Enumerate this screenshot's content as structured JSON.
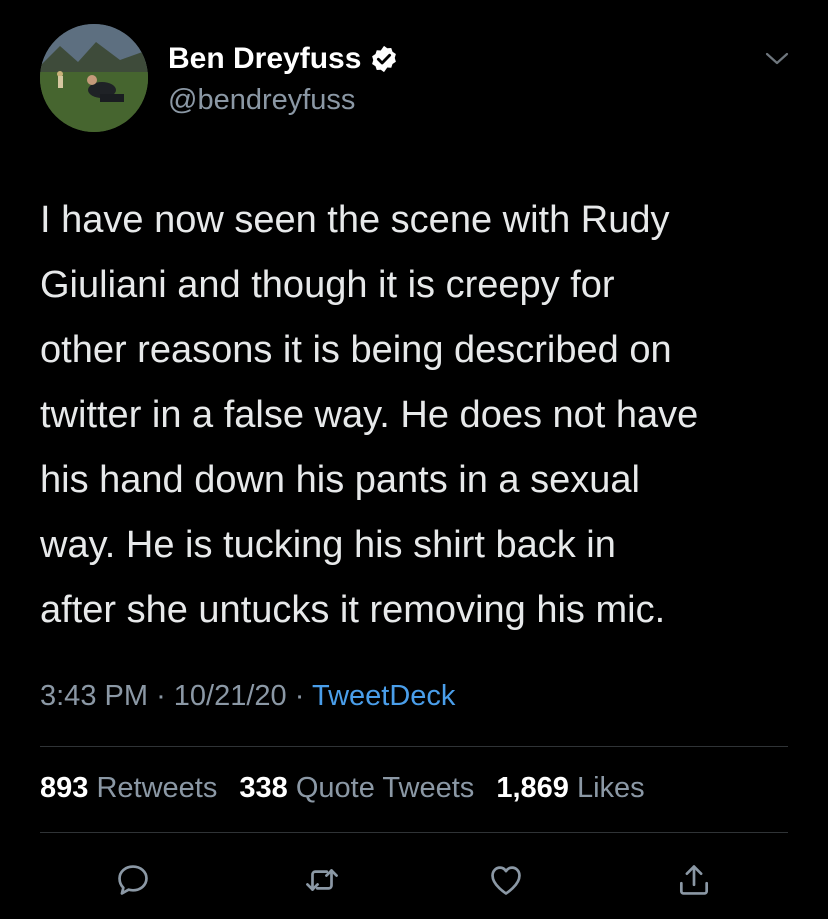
{
  "author": {
    "name": "Ben Dreyfuss",
    "handle": "@bendreyfuss",
    "verified": true
  },
  "tweet": {
    "text": "I have now seen the scene with Rudy\nGiuliani and though it is creepy for\nother reasons it is being described on\ntwitter in a false way. He does not have\nhis hand down his pants in a sexual\nway. He is tucking his shirt back in\nafter she untucks it removing his mic.",
    "time": "3:43 PM",
    "separator": "·",
    "date": "10/21/20",
    "source": "TweetDeck"
  },
  "stats": {
    "retweets_count": "893",
    "retweets_label": "Retweets",
    "quotes_count": "338",
    "quotes_label": "Quote Tweets",
    "likes_count": "1,869",
    "likes_label": "Likes"
  },
  "icons": {
    "verified": "verified-badge-icon",
    "menu": "chevron-down-icon",
    "reply": "reply-icon",
    "retweet": "retweet-icon",
    "like": "heart-icon",
    "share": "share-icon"
  },
  "colors": {
    "background": "#000000",
    "link": "#4a9eea",
    "muted": "#8b98a5",
    "text": "#e7e9ea"
  }
}
